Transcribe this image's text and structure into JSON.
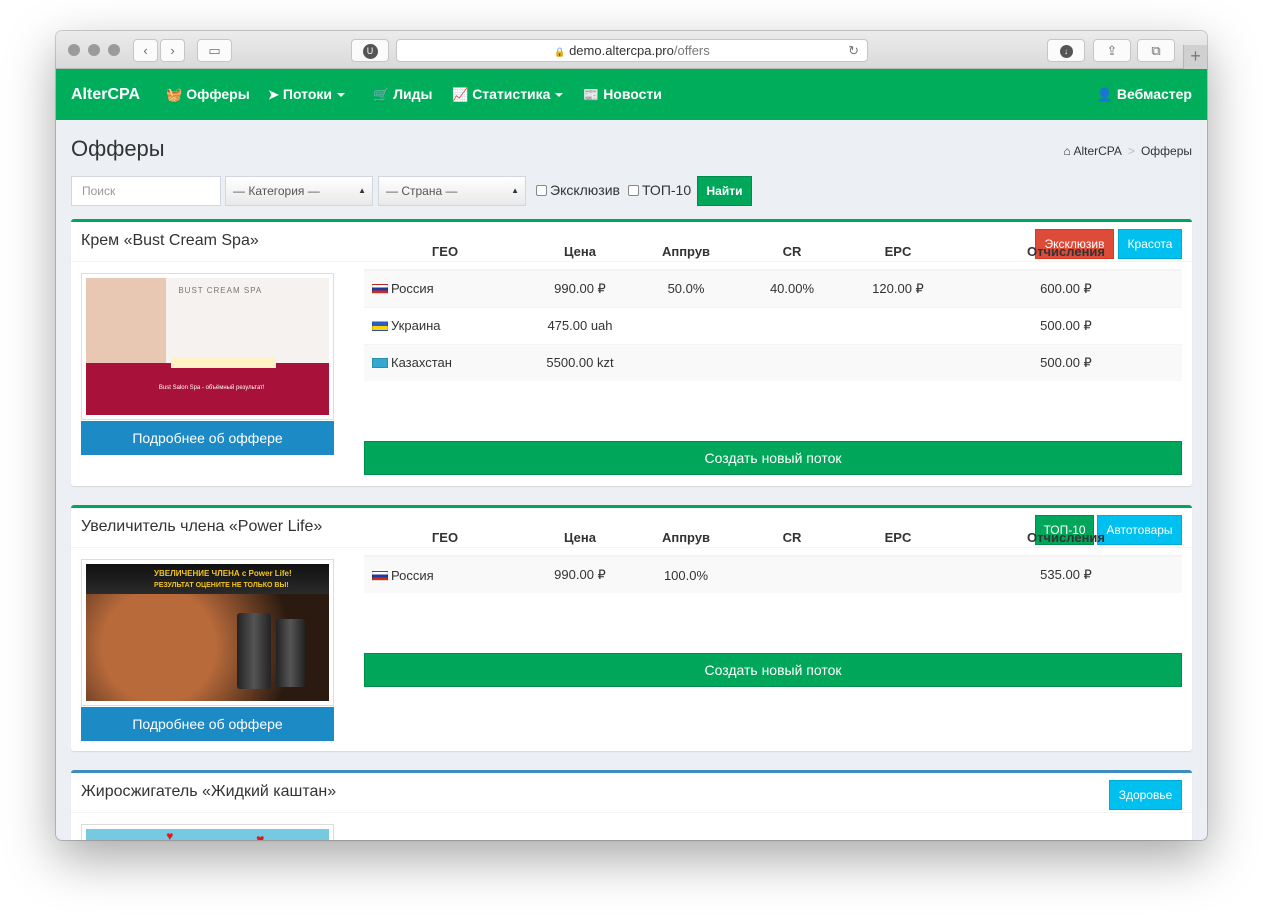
{
  "browser": {
    "url_host": "demo.altercpa.pro",
    "url_path": "/offers",
    "extension_letter": "U"
  },
  "navbar": {
    "brand": "AlterCPA",
    "items": [
      {
        "label": "Офферы",
        "icon": "basket-icon"
      },
      {
        "label": "Потоки",
        "icon": "paper-plane-icon",
        "dropdown": true
      },
      {
        "label": "Лиды",
        "icon": "cart-icon"
      },
      {
        "label": "Статистика",
        "icon": "area-chart-icon",
        "dropdown": true
      },
      {
        "label": "Новости",
        "icon": "newspaper-icon"
      }
    ],
    "user": "Вебмастер"
  },
  "page": {
    "title": "Офферы",
    "breadcrumb": [
      "AlterCPA",
      "Офферы"
    ]
  },
  "filter": {
    "search_placeholder": "Поиск",
    "category": "— Категория —",
    "country": "— Страна —",
    "exclusive_label": "Эксклюзив",
    "top10_label": "ТОП-10",
    "submit": "Найти"
  },
  "table_headers": [
    "ГЕО",
    "Цена",
    "Аппрув",
    "CR",
    "EPC",
    "Отчисления"
  ],
  "offers": [
    {
      "title": "Крем «Bust Cream Spa»",
      "tags": [
        {
          "label": "Эксклюзив",
          "color": "#dd4b39"
        },
        {
          "label": "Красота",
          "color": "#00c0ef"
        }
      ],
      "image_caption": "BUST CREAM SPA",
      "image_subcaption": "Bust Salon Spa - объёмный результат!",
      "details_button": "Подробнее об оффере",
      "create_button": "Создать новый поток",
      "rows": [
        {
          "geo": "Россия",
          "flag": "ru",
          "price": "990.00 ₽",
          "approve": "50.0%",
          "cr": "40.00%",
          "epc": "120.00 ₽",
          "payout": "600.00 ₽"
        },
        {
          "geo": "Украина",
          "flag": "ua",
          "price": "475.00 uah",
          "approve": "",
          "cr": "",
          "epc": "",
          "payout": "500.00 ₽"
        },
        {
          "geo": "Казахстан",
          "flag": "kz",
          "price": "5500.00 kzt",
          "approve": "",
          "cr": "",
          "epc": "",
          "payout": "500.00 ₽"
        }
      ]
    },
    {
      "title": "Увеличитель члена «Power Life»",
      "tags": [
        {
          "label": "ТОП-10",
          "color": "#00a65a"
        },
        {
          "label": "Автотовары",
          "color": "#00c0ef"
        }
      ],
      "image_caption": "УВЕЛИЧЕНИЕ ЧЛЕНА с Power Life!",
      "image_subcaption": "РЕЗУЛЬТАТ ОЦЕНИТЕ НЕ ТОЛЬКО ВЫ!",
      "details_button": "Подробнее об оффере",
      "create_button": "Создать новый поток",
      "rows": [
        {
          "geo": "Россия",
          "flag": "ru",
          "price": "990.00 ₽",
          "approve": "100.0%",
          "cr": "",
          "epc": "",
          "payout": "535.00 ₽"
        }
      ]
    },
    {
      "title": "Жиросжигатель «Жидкий каштан»",
      "tags": [
        {
          "label": "Здоровье",
          "color": "#00c0ef"
        }
      ]
    }
  ]
}
